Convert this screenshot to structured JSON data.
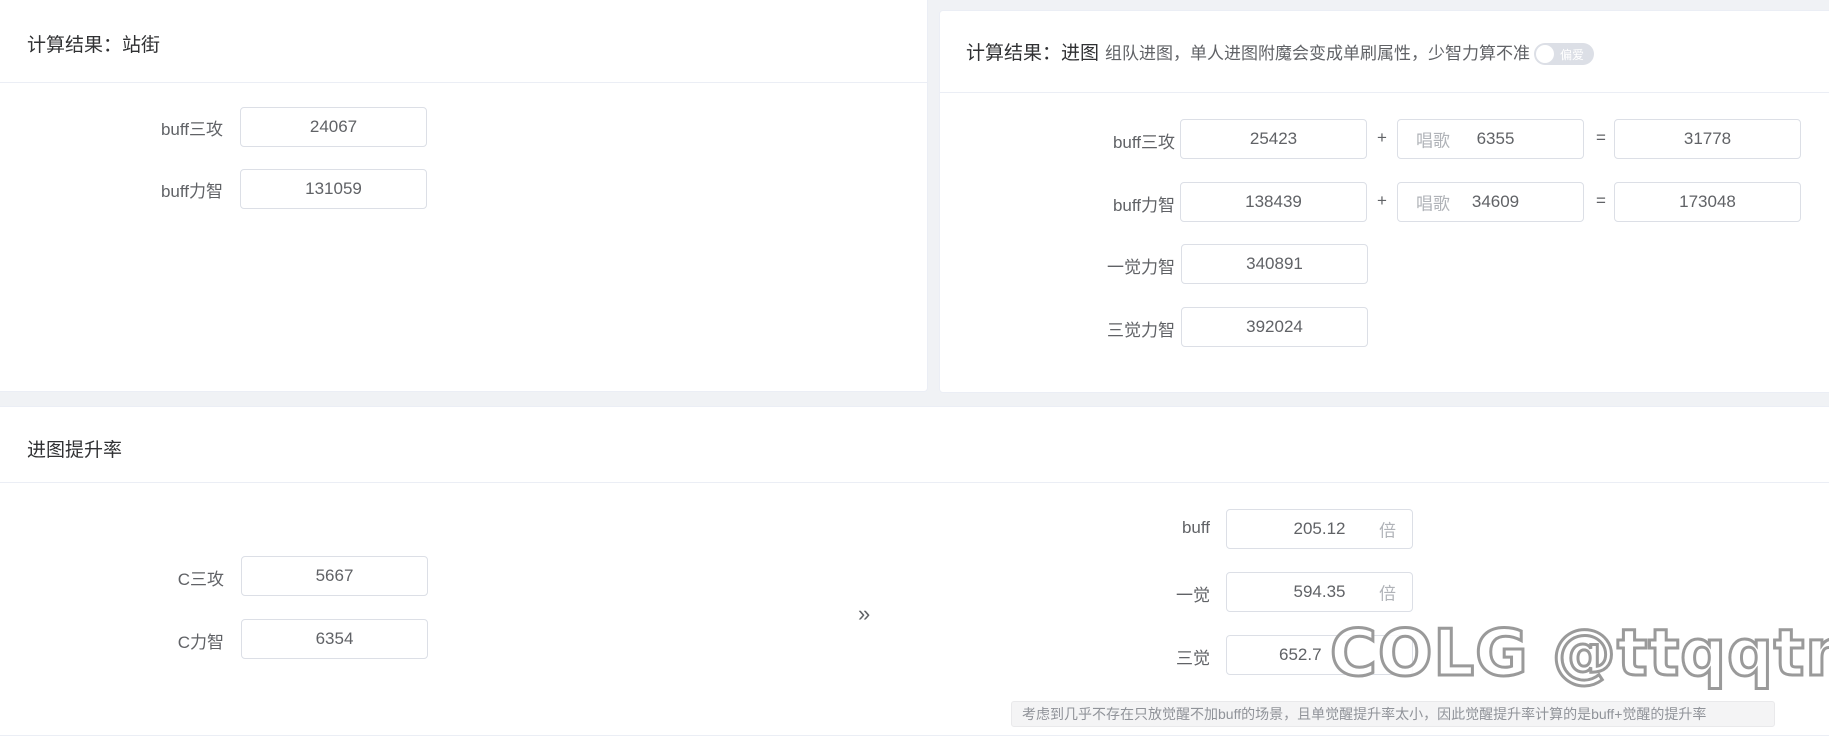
{
  "standing": {
    "title": "计算结果：站街",
    "rows": [
      {
        "label": "buff三攻",
        "value": "24067"
      },
      {
        "label": "buff力智",
        "value": "131059"
      }
    ]
  },
  "dungeon": {
    "title": "计算结果：进图",
    "hint": "组队进图，单人进图附魔会变成单刷属性，少智力算不准",
    "toggle_label": "偏爱",
    "rows": [
      {
        "label": "buff三攻",
        "value": "25423",
        "plus": "+",
        "song_prefix": "唱歌",
        "song_value": "6355",
        "eq": "=",
        "total": "31778"
      },
      {
        "label": "buff力智",
        "value": "138439",
        "plus": "+",
        "song_prefix": "唱歌",
        "song_value": "34609",
        "eq": "=",
        "total": "173048"
      },
      {
        "label": "一觉力智",
        "value": "340891"
      },
      {
        "label": "三觉力智",
        "value": "392024"
      }
    ]
  },
  "rate": {
    "title": "进图提升率",
    "left": [
      {
        "label": "C三攻",
        "value": "5667"
      },
      {
        "label": "C力智",
        "value": "6354"
      }
    ],
    "arrow": "»",
    "right": [
      {
        "label": "buff",
        "value": "205.12",
        "suffix": "倍"
      },
      {
        "label": "一觉",
        "value": "594.35",
        "suffix": "倍"
      },
      {
        "label": "三觉",
        "value": "652.7",
        "suffix": ""
      }
    ],
    "note": "考虑到几乎不存在只放觉醒不加buff的场景，且单觉醒提升率太小，因此觉醒提升率计算的是buff+觉醒的提升率"
  },
  "watermark": "COLG @ttqqtme"
}
